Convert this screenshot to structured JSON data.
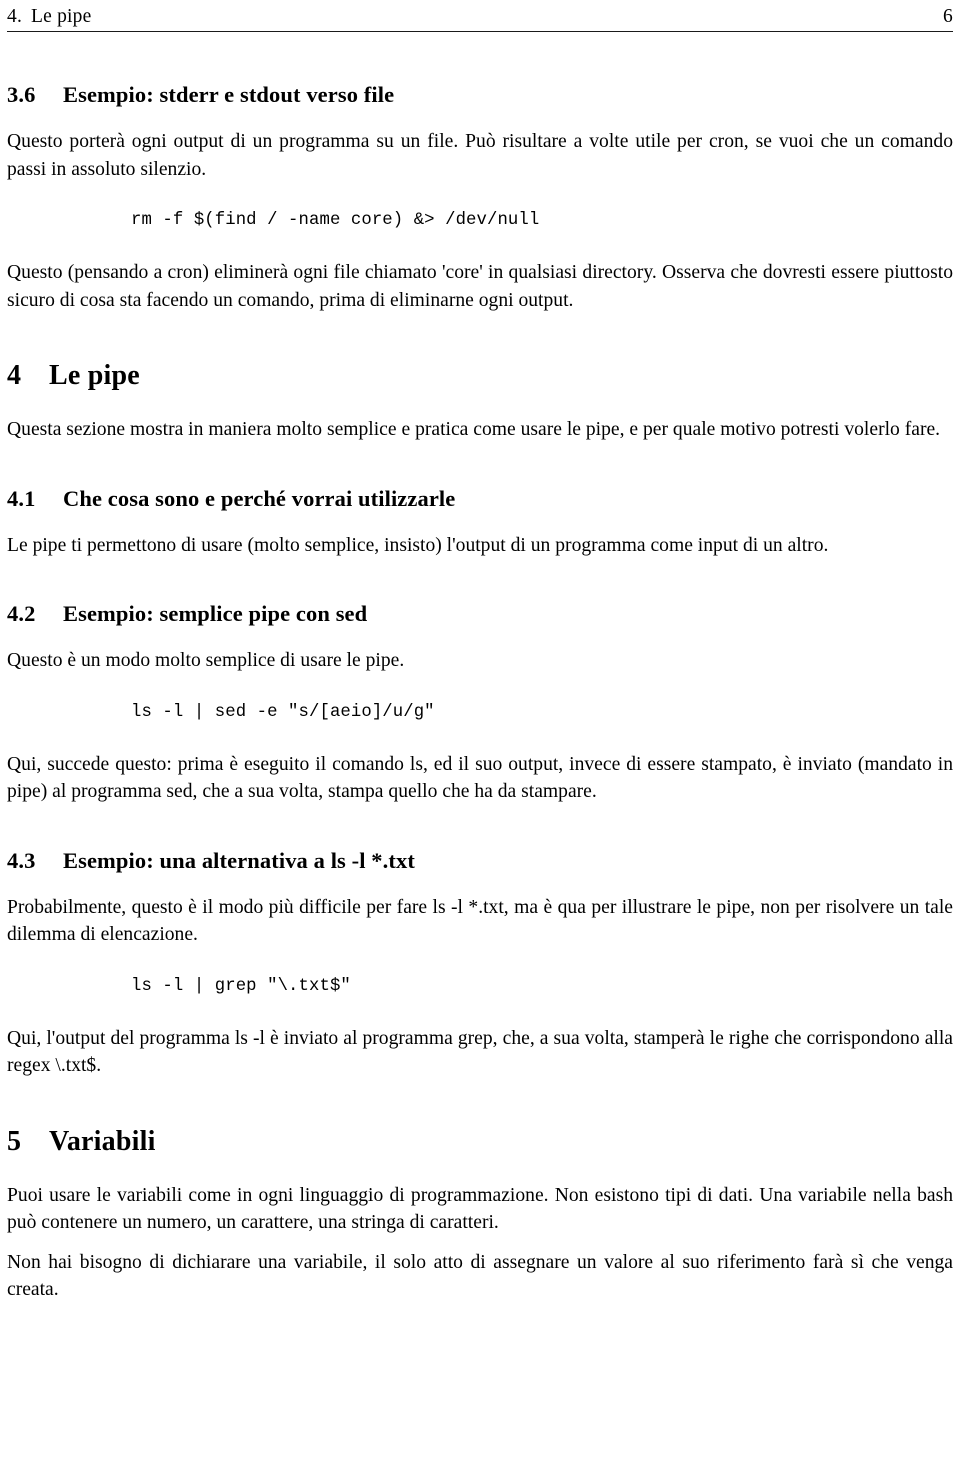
{
  "header": {
    "chapter_number": "4.",
    "chapter_title": "Le pipe",
    "page_number": "6"
  },
  "sections": {
    "sec_3_6": {
      "number": "3.6",
      "title": "Esempio: stderr e stdout verso file",
      "paragraph_1": "Questo porterà ogni output di un programma su un file. Può risultare a volte utile per cron, se vuoi che un comando passi in assoluto silenzio.",
      "code_1": "rm -f $(find / -name core) &> /dev/null",
      "paragraph_2": "Questo (pensando a cron) eliminerà ogni file chiamato 'core' in qualsiasi directory. Osserva che dovresti essere piuttosto sicuro di cosa sta facendo un comando, prima di eliminarne ogni output."
    },
    "sec_4": {
      "number": "4",
      "title": "Le pipe",
      "paragraph_1": "Questa sezione mostra in maniera molto semplice e pratica come usare le pipe, e per quale motivo potresti volerlo fare."
    },
    "sec_4_1": {
      "number": "4.1",
      "title": "Che cosa sono e perché vorrai utilizzarle",
      "paragraph_1": "Le pipe ti permettono di usare (molto semplice, insisto) l'output di un programma come input di un altro."
    },
    "sec_4_2": {
      "number": "4.2",
      "title": "Esempio: semplice pipe con sed",
      "paragraph_1": "Questo è un modo molto semplice di usare le pipe.",
      "code_1": "ls -l | sed -e \"s/[aeio]/u/g\"",
      "paragraph_2": "Qui, succede questo: prima è eseguito il comando ls, ed il suo output, invece di essere stampato, è inviato (mandato in pipe) al programma sed, che a sua volta, stampa quello che ha da stampare."
    },
    "sec_4_3": {
      "number": "4.3",
      "title": "Esempio: una alternativa a ls -l *.txt",
      "paragraph_1": "Probabilmente, questo è il modo più difficile per fare ls -l *.txt, ma è qua per illustrare le pipe, non per risolvere un tale dilemma di elencazione.",
      "code_1": "ls -l | grep \"\\.txt$\"",
      "paragraph_2": "Qui, l'output del programma ls -l è inviato al programma grep, che, a sua volta, stamperà le righe che corrispondono alla regex \\.txt$."
    },
    "sec_5": {
      "number": "5",
      "title": "Variabili",
      "paragraph_1": "Puoi usare le variabili come in ogni linguaggio di programmazione. Non esistono tipi di dati. Una variabile nella bash può contenere un numero, un carattere, una stringa di caratteri.",
      "paragraph_2": "Non hai bisogno di dichiarare una variabile, il solo atto di assegnare un valore al suo riferimento farà sì che venga creata."
    }
  }
}
